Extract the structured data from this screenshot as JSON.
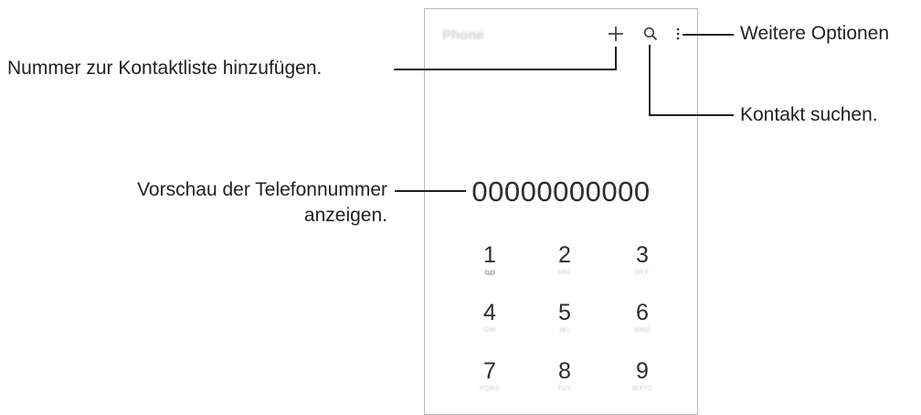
{
  "phone": {
    "app_title": "Phone",
    "number": "00000000000",
    "keypad": [
      {
        "digit": "1",
        "letters": ""
      },
      {
        "digit": "2",
        "letters": "ABC"
      },
      {
        "digit": "3",
        "letters": "DEF"
      },
      {
        "digit": "4",
        "letters": "GHI"
      },
      {
        "digit": "5",
        "letters": "JKL"
      },
      {
        "digit": "6",
        "letters": "MNO"
      },
      {
        "digit": "7",
        "letters": "PQRS"
      },
      {
        "digit": "8",
        "letters": "TUV"
      },
      {
        "digit": "9",
        "letters": "WXYZ"
      }
    ]
  },
  "callouts": {
    "more_options": "Weitere Optionen",
    "add_contact": "Nummer zur Kontaktliste hinzufügen.",
    "search_contact": "Kontakt suchen.",
    "preview_line1": "Vorschau der Telefonnummer",
    "preview_line2": "anzeigen."
  },
  "icons": [
    "plus-icon",
    "search-icon",
    "more-options-icon",
    "voicemail-icon"
  ],
  "colors": {
    "text": "#231f20",
    "frame": "#b9b9b9",
    "muted": "#c8c8c8"
  }
}
